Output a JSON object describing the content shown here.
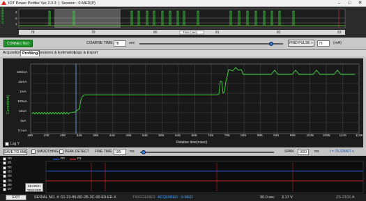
{
  "window": {
    "title": "IOT Power Profiler Ver 2.3.3",
    "session": "Session : 0-MED(P)",
    "minimize": "–",
    "maximize": "□",
    "close": "✕"
  },
  "overview": {
    "y_axis_label": "Current(mA)",
    "x_ticks": [
      "78",
      "79",
      "80",
      "81",
      "82",
      "83"
    ],
    "x_axis_label": "Time (sec)",
    "channel_labels": [
      "2",
      "0",
      "1"
    ]
  },
  "controls": {
    "connected_label": "CONNECTED",
    "coarse_time_label": "COARSE TIME",
    "coarse_time_value": "78",
    "coarse_time_unit": "sec",
    "find_pulse_label": "FIND PULSE >",
    "pulse_value": "75",
    "pulse_unit": "(mA)"
  },
  "tabs": [
    {
      "label": "Acquisition",
      "active": false
    },
    {
      "label": "Profiling",
      "active": true
    },
    {
      "label": "Sessions & Estimation",
      "active": false
    },
    {
      "label": "Logs & Export",
      "active": false
    }
  ],
  "main_plot": {
    "y_axis_label": "Current(mA)",
    "y_ticks": [
      "100mA",
      "10mA",
      "1mA",
      "100uA",
      "10uA",
      "1uA",
      "0.1uA"
    ],
    "x_ticks": [
      "195",
      "245",
      "295",
      "345",
      "395",
      "445",
      "495",
      "545",
      "595",
      "645",
      "695",
      "745",
      "795",
      "845",
      "895",
      "945",
      "995",
      "1045",
      "1095",
      "1145",
      "1195"
    ],
    "x_axis_label": "Relative time(msec)",
    "log_y_label": "Log Y"
  },
  "mid_controls": {
    "save_to_xml": "SAVE TO XML",
    "smoothing": "SMOOTHING",
    "peak_detect": "PEAK DETECT",
    "fine_time_label": "FINE TIME",
    "fine_time_value": "195",
    "fine_time_unit": "ms",
    "span_label": "SPAN",
    "span_value": "1000",
    "span_unit": "ms",
    "cursor_readout": "t = 78.328407 s"
  },
  "lower_panel": {
    "channel_checks": [
      "D0",
      "D1",
      "D2",
      "D3",
      "D4",
      "D5",
      "D6",
      "D7"
    ],
    "legend": [
      "D0",
      "D1"
    ],
    "search_trigger": "SEARCH TRIGGER",
    "legend_colors": {
      "d0": "#2266ff",
      "d1": "#ff3333"
    }
  },
  "status_bar": {
    "exit_label": "EXIT",
    "serial_no": "SERIAL NO. #: 01-23-89-8D-2B-3C-00-E9-EE-X",
    "triggered": "TRIGGERED",
    "acquired": "ACQUIRED : 0-MED",
    "time": "90.0 sec",
    "voltage": "3.17 V",
    "status_right": "ZS-2102-A"
  },
  "colors": {
    "plot_trace": "#3edc3e",
    "cursor": "#7fb2ff",
    "overview_highlight": "#8a8a8a",
    "red_marker": "#e03030"
  }
}
